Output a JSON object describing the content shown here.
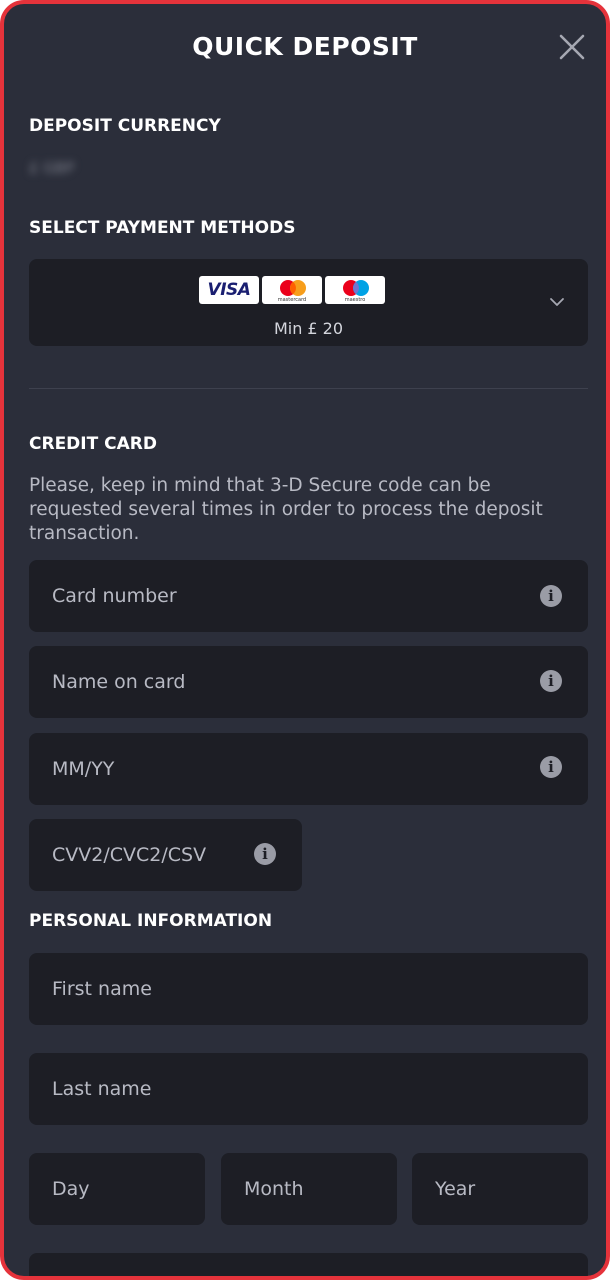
{
  "dialog": {
    "title": "QUICK DEPOSIT",
    "close_icon": "close-icon"
  },
  "currency": {
    "label": "DEPOSIT CURRENCY",
    "value": "£ GBP"
  },
  "payment_methods": {
    "label": "SELECT PAYMENT METHODS",
    "logos": [
      "VISA",
      "mastercard",
      "maestro"
    ],
    "min_text": "Min £ 20",
    "dropdown_icon": "chevron-down-icon"
  },
  "credit_card": {
    "label": "CREDIT CARD",
    "notice": "Please, keep in mind that 3-D Secure code can be requested several times in order to process the deposit transaction.",
    "fields": {
      "card_number": "Card number",
      "name_on_card": "Name on card",
      "expiry": "MM/YY",
      "cvv": "CVV2/CVC2/CSV"
    },
    "info_icon": "info-icon"
  },
  "personal_info": {
    "label": "PERSONAL INFORMATION",
    "fields": {
      "first_name": "First name",
      "last_name": "Last name",
      "day": "Day",
      "month": "Month",
      "year": "Year"
    }
  },
  "colors": {
    "background": "#2b2e3a",
    "field": "#1d1e25",
    "frame_border": "#e5333b",
    "text": "#ffffff",
    "placeholder": "#b8bac4"
  }
}
